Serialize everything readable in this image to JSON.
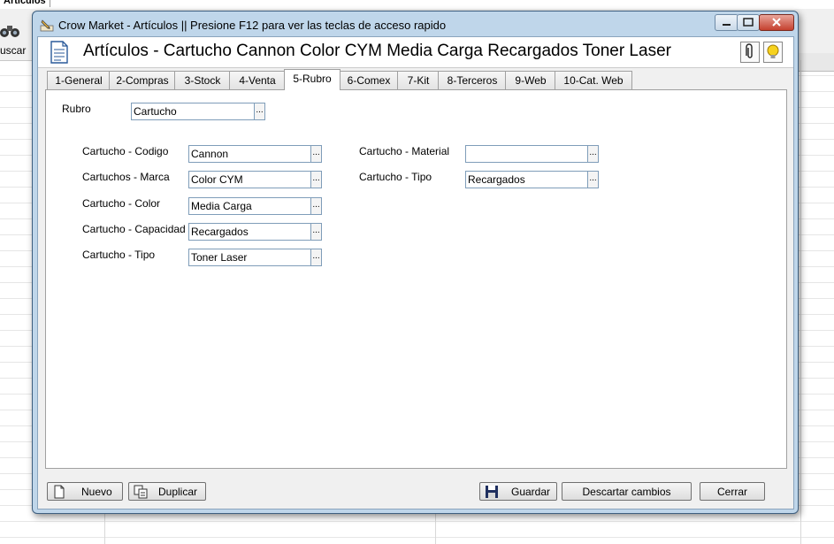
{
  "background": {
    "tab_label": "Articulos",
    "search_label": "uscar"
  },
  "window": {
    "title": "Crow Market - Artículos || Presione F12 para ver las teclas de acceso rapido"
  },
  "header": {
    "title": "Artículos  - Cartucho Cannon Color CYM Media Carga Recargados Toner Laser"
  },
  "tabs": [
    {
      "label": "1-General"
    },
    {
      "label": "2-Compras"
    },
    {
      "label": "3-Stock"
    },
    {
      "label": "4-Venta"
    },
    {
      "label": "5-Rubro",
      "active": true
    },
    {
      "label": "6-Comex"
    },
    {
      "label": "7-Kit"
    },
    {
      "label": "8-Terceros"
    },
    {
      "label": "9-Web"
    },
    {
      "label": "10-Cat. Web"
    }
  ],
  "rubro": {
    "label": "Rubro",
    "value": "Cartucho"
  },
  "left_fields": [
    {
      "label": "Cartucho - Codigo",
      "value": "Cannon"
    },
    {
      "label": "Cartuchos - Marca",
      "value": "Color CYM"
    },
    {
      "label": "Cartucho - Color",
      "value": "Media Carga"
    },
    {
      "label": "Cartucho - Capacidad",
      "value": "Recargados"
    },
    {
      "label": "Cartucho - Tipo",
      "value": "Toner Laser"
    }
  ],
  "right_fields": [
    {
      "label": "Cartucho - Material",
      "value": ""
    },
    {
      "label": "Cartucho - Tipo",
      "value": "Recargados"
    }
  ],
  "ellipsis": "...",
  "buttons": {
    "nuevo": "Nuevo",
    "duplicar": "Duplicar",
    "guardar": "Guardar",
    "descartar": "Descartar cambios",
    "cerrar": "Cerrar"
  },
  "colors": {
    "frame": "#bfd6ea",
    "close_button": "#c4402e",
    "field_border": "#7f9db9"
  }
}
